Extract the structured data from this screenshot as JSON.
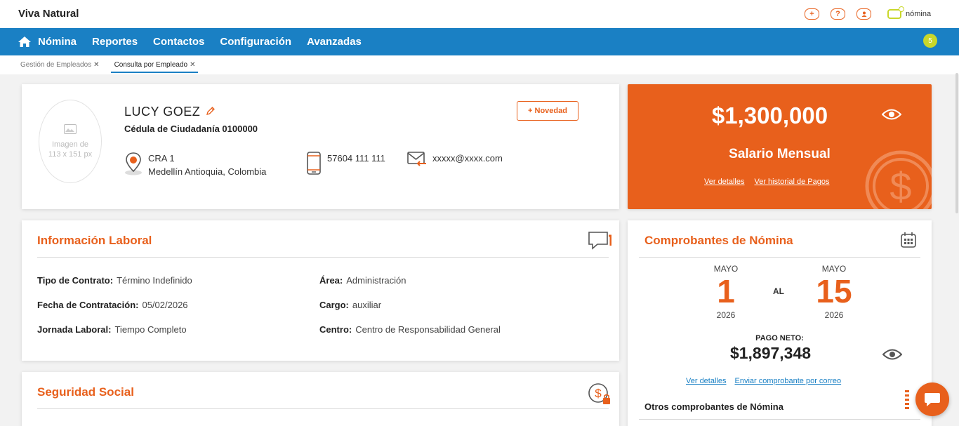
{
  "header": {
    "brand": "Viva Natural",
    "product": "nómina"
  },
  "nav": {
    "items": [
      {
        "label": "Nómina"
      },
      {
        "label": "Reportes"
      },
      {
        "label": "Contactos"
      },
      {
        "label": "Configuración"
      },
      {
        "label": "Avanzadas"
      }
    ],
    "notifications": "5"
  },
  "tabs": [
    {
      "label": "Gestión de Empleados"
    },
    {
      "label": "Consulta por Empleado"
    }
  ],
  "profile": {
    "photo_placeholder_line1": "Imagen de",
    "photo_placeholder_line2": "113 x 151 px",
    "name": "LUCY GOEZ",
    "id": "Cédula de Ciudadanía 0100000",
    "novedad_button": "+ Novedad",
    "address_line1": "CRA 1",
    "address_line2": "Medellín Antioquia, Colombia",
    "phone": "57604 111 111",
    "email": "xxxxx@xxxx.com"
  },
  "salary": {
    "amount": "$1,300,000",
    "label": "Salario Mensual",
    "link_details": "Ver detalles",
    "link_history": "Ver historial de Pagos"
  },
  "labor": {
    "title": "Información Laboral",
    "contract_label": "Tipo de Contrato:",
    "contract_value": "Término Indefinido",
    "hire_label": "Fecha de Contratación:",
    "hire_value": "05/02/2026",
    "shift_label": "Jornada Laboral:",
    "shift_value": "Tiempo Completo",
    "area_label": "Área:",
    "area_value": "Administración",
    "role_label": "Cargo:",
    "role_value": "auxiliar",
    "center_label": "Centro:",
    "center_value": "Centro de Responsabilidad General"
  },
  "social": {
    "title": "Seguridad Social"
  },
  "receipts": {
    "title": "Comprobantes de Nómina",
    "from_month": "MAYO",
    "from_day": "1",
    "from_year": "2026",
    "separator": "AL",
    "to_month": "MAYO",
    "to_day": "15",
    "to_year": "2026",
    "net_label": "PAGO NETO:",
    "net_amount": "$1,897,348",
    "link_details": "Ver detalles",
    "link_email": "Enviar comprobante por correo",
    "others": "Otros comprobantes de Nómina"
  },
  "colors": {
    "accent": "#e8601c",
    "nav": "#1a80c4",
    "badge": "#c9d72a"
  }
}
